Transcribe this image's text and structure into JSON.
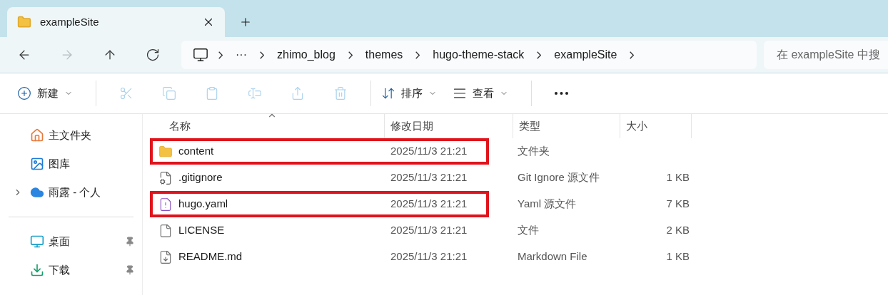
{
  "tabs": [
    {
      "title": "exampleSite",
      "selected": true
    }
  ],
  "nav": [
    {
      "kind": "back",
      "disabled": false
    },
    {
      "kind": "forward",
      "disabled": true
    },
    {
      "kind": "up",
      "disabled": false
    },
    {
      "kind": "refresh",
      "disabled": false
    }
  ],
  "breadcrumb": [
    "···",
    "zhimo_blog",
    "themes",
    "hugo-theme-stack",
    "exampleSite"
  ],
  "search": {
    "placeholder": "在 exampleSite 中搜"
  },
  "toolbar": [
    {
      "kind": "new",
      "label": "新建",
      "disabled": false
    },
    {
      "kind": "cut",
      "disabled": true
    },
    {
      "kind": "copy",
      "disabled": true
    },
    {
      "kind": "paste",
      "disabled": true
    },
    {
      "kind": "rename",
      "disabled": true
    },
    {
      "kind": "share",
      "disabled": true
    },
    {
      "kind": "delete",
      "disabled": true
    },
    {
      "kind": "sort",
      "label": "排序",
      "disabled": false
    },
    {
      "kind": "view",
      "label": "查看",
      "disabled": false
    },
    {
      "kind": "more",
      "disabled": false
    }
  ],
  "sidebar": {
    "items": [
      {
        "kind": "home",
        "label": "主文件夹",
        "pinned": false,
        "expandable": false
      },
      {
        "kind": "gallery",
        "label": "图库",
        "pinned": false,
        "expandable": false
      },
      {
        "kind": "cloud",
        "label": "雨露 - 个人",
        "pinned": false,
        "expandable": true
      },
      {
        "kind": "desktop",
        "label": "桌面",
        "pinned": true,
        "expandable": false
      },
      {
        "kind": "downloads",
        "label": "下载",
        "pinned": true,
        "expandable": false
      }
    ]
  },
  "table": {
    "columns": [
      {
        "label": "名称",
        "sorted": true
      },
      {
        "label": "修改日期",
        "sorted": false
      },
      {
        "label": "类型",
        "sorted": false
      },
      {
        "label": "大小",
        "sorted": false
      }
    ],
    "rows": [
      {
        "kind": "folder",
        "name": "content",
        "date": "2025/11/3 21:21",
        "type": "文件夹",
        "highlighted": true
      },
      {
        "kind": "config",
        "name": ".gitignore",
        "date": "2025/11/3 21:21",
        "type": "Git Ignore 源文件",
        "size": "1 KB",
        "highlighted": false
      },
      {
        "kind": "yaml",
        "name": "hugo.yaml",
        "date": "2025/11/3 21:21",
        "type": "Yaml 源文件",
        "size": "7 KB",
        "highlighted": true
      },
      {
        "kind": "plain",
        "name": "LICENSE",
        "date": "2025/11/3 21:21",
        "type": "文件",
        "size": "2 KB",
        "highlighted": false
      },
      {
        "kind": "markdown",
        "name": "README.md",
        "date": "2025/11/3 21:21",
        "type": "Markdown File",
        "size": "1 KB",
        "highlighted": false
      }
    ]
  }
}
